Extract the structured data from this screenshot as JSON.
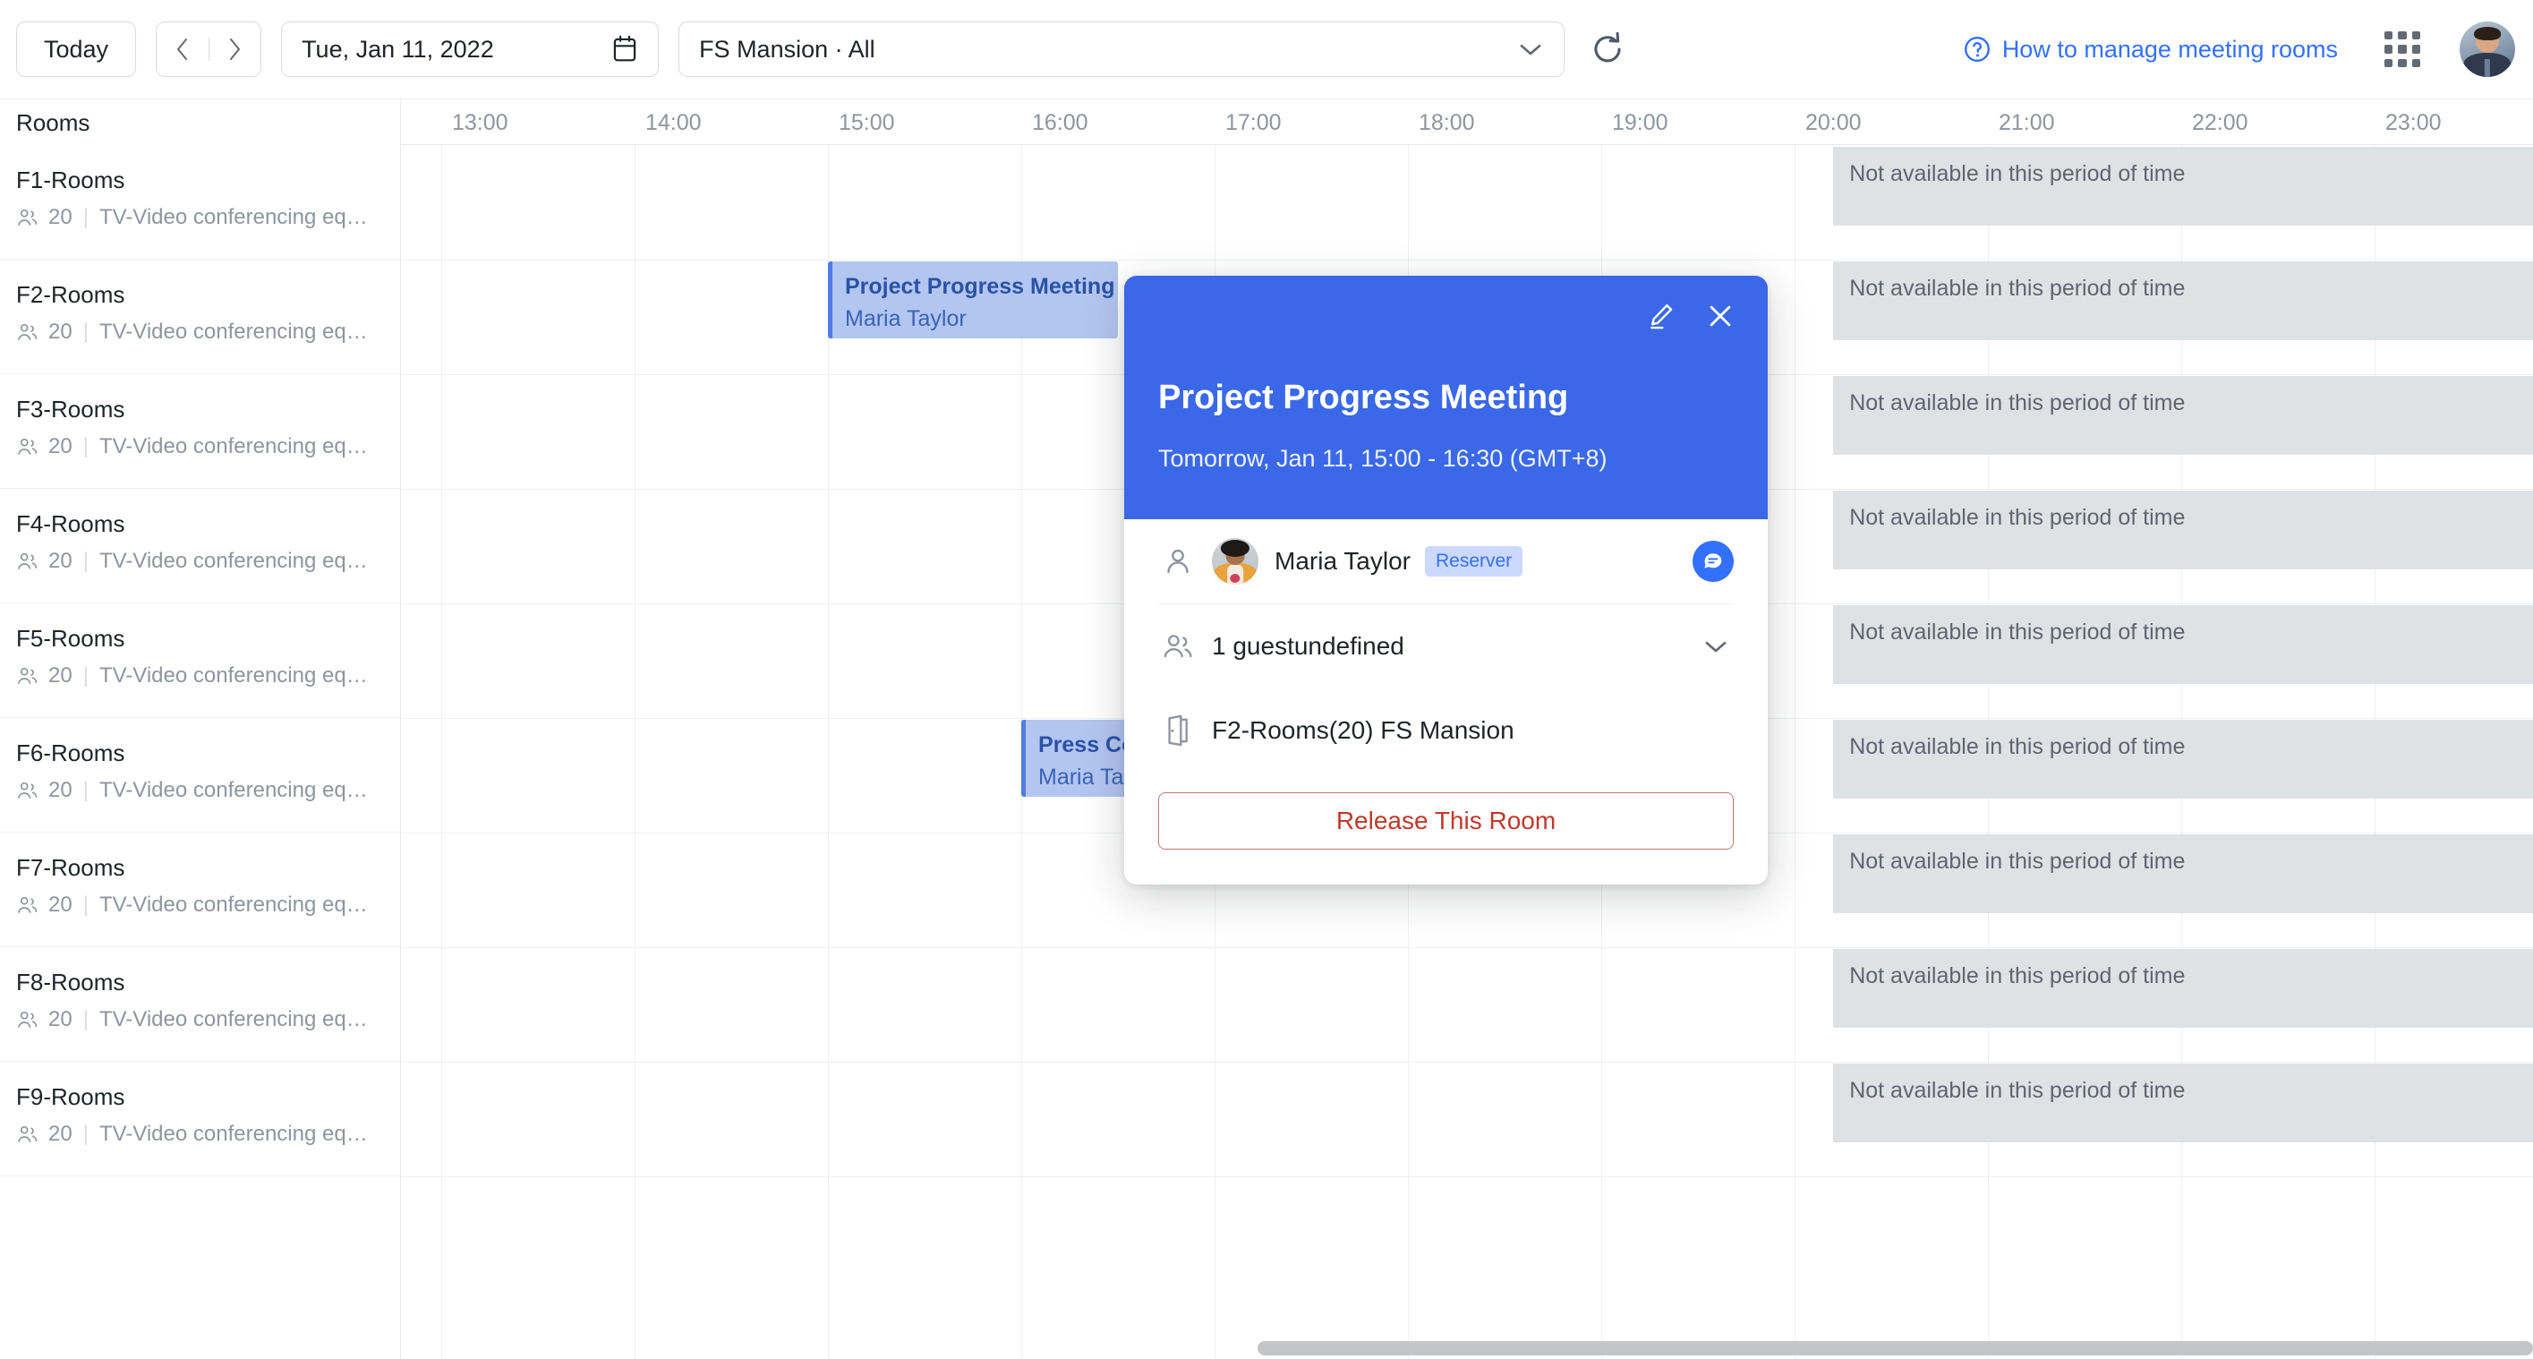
{
  "toolbar": {
    "today_label": "Today",
    "prev_icon": "chevron-left-icon",
    "next_icon": "chevron-right-icon",
    "date_value": "Tue, Jan 11, 2022",
    "calendar_icon": "calendar-icon",
    "room_filter_value": "FS Mansion · All",
    "chevron_icon": "chevron-down-icon",
    "refresh_icon": "refresh-icon",
    "help_link": "How to manage meeting rooms",
    "help_icon": "question-circle-icon",
    "apps_icon": "apps-grid-icon",
    "avatar_label": "user-avatar"
  },
  "grid": {
    "rooms_header": "Rooms",
    "time_labels": [
      "13:00",
      "14:00",
      "15:00",
      "16:00",
      "17:00",
      "18:00",
      "19:00",
      "20:00",
      "21:00",
      "22:00",
      "23:00"
    ],
    "capacity_icon": "people-icon",
    "rooms": [
      {
        "name": "F1-Rooms",
        "capacity": "20",
        "equipment": "TV-Video conferencing equi..."
      },
      {
        "name": "F2-Rooms",
        "capacity": "20",
        "equipment": "TV-Video conferencing equi..."
      },
      {
        "name": "F3-Rooms",
        "capacity": "20",
        "equipment": "TV-Video conferencing equi..."
      },
      {
        "name": "F4-Rooms",
        "capacity": "20",
        "equipment": "TV-Video conferencing equi..."
      },
      {
        "name": "F5-Rooms",
        "capacity": "20",
        "equipment": "TV-Video conferencing equi..."
      },
      {
        "name": "F6-Rooms",
        "capacity": "20",
        "equipment": "TV-Video conferencing equi..."
      },
      {
        "name": "F7-Rooms",
        "capacity": "20",
        "equipment": "TV-Video conferencing equi..."
      },
      {
        "name": "F8-Rooms",
        "capacity": "20",
        "equipment": "TV-Video conferencing equi..."
      },
      {
        "name": "F9-Rooms",
        "capacity": "20",
        "equipment": "TV-Video conferencing equi..."
      }
    ],
    "events": [
      {
        "title": "Project Progress Meeting",
        "organizer": "Maria Taylor",
        "row": 1,
        "start_hour": 15.0,
        "end_hour": 16.5
      },
      {
        "title": "Press Co",
        "organizer": "Maria Ta",
        "row": 5,
        "start_hour": 16.0,
        "end_hour": 17.5
      }
    ],
    "unavailable_label": "Not available in this period of time",
    "unavailable_rows": [
      0,
      1,
      2,
      3,
      4,
      5,
      6,
      7,
      8
    ],
    "unavailable_start_hour": 20.2
  },
  "popup": {
    "title": "Project Progress Meeting",
    "time": "Tomorrow, Jan 11, 15:00 - 16:30 (GMT+8)",
    "edit_icon": "pencil-icon",
    "close_icon": "close-icon",
    "person_icon": "person-icon",
    "reserver_name": "Maria Taylor",
    "reserver_badge": "Reserver",
    "chat_icon": "chat-icon",
    "guests_icon": "people-icon",
    "guests_text": "1 guestundefined",
    "guests_chevron_icon": "chevron-down-icon",
    "room_icon": "door-icon",
    "room_text": "F2-Rooms(20) FS Mansion",
    "release_button": "Release This Room",
    "header_color": "#3a68e8",
    "release_color": "#c0392b"
  },
  "scrollbar": {
    "name": "horizontal-scrollbar"
  }
}
